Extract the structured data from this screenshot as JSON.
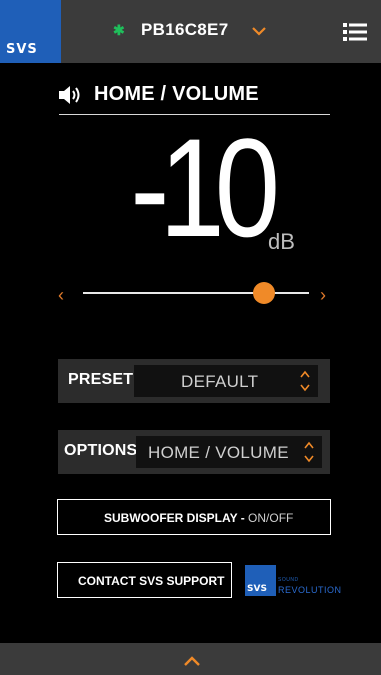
{
  "header": {
    "logo_text": "SVS",
    "device_name": "PB16C8E7",
    "bluetooth_symbol": "✱",
    "icons": [
      "bluetooth-icon",
      "chevron-down-icon",
      "menu-list-icon"
    ],
    "accent_color": "#f08a28"
  },
  "section": {
    "title": "HOME / VOLUME",
    "icon": "speaker-volume-icon"
  },
  "volume": {
    "value": "-10",
    "unit": "dB",
    "slider_fraction": 0.8,
    "dec_symbol": "‹",
    "inc_symbol": "›"
  },
  "preset": {
    "label": "PRESET",
    "value": "DEFAULT"
  },
  "options": {
    "label": "OPTIONS",
    "value": "HOME / VOLUME"
  },
  "buttons": {
    "subwoofer_display_label": "SUBWOOFER DISPLAY -",
    "subwoofer_display_state": "ON/OFF",
    "contact_support_label": "CONTACT SVS SUPPORT"
  },
  "sound_revolution": {
    "logo_text": "SVS",
    "top": "SOUND",
    "bottom": "REVOLUTION"
  },
  "footer": {
    "icon": "chevron-up-icon"
  },
  "colors": {
    "bar": "#3b3b3b",
    "brand_blue": "#1f5fb8",
    "accent_orange": "#f08a28",
    "bluetooth_green": "#1fbf5b"
  }
}
